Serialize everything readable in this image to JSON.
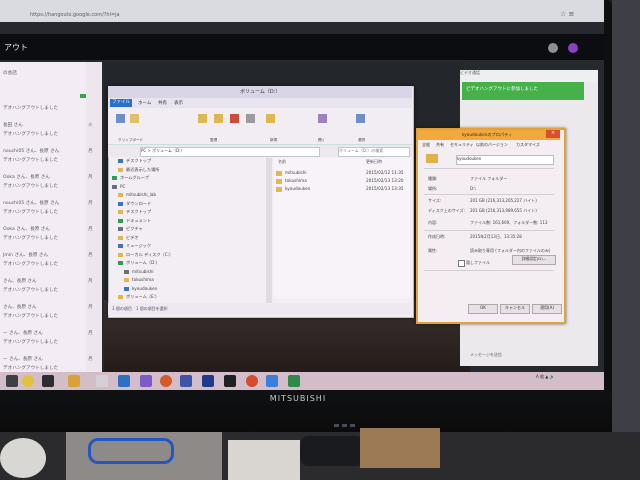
{
  "browser": {
    "url": "https://hangouts.google.com/?hl=ja",
    "chrome_icons": "☆ ≡"
  },
  "hangouts": {
    "title": "アウト",
    "conversations": [
      {
        "name": "の会話",
        "time": "",
        "msg": ""
      },
      {
        "name": "",
        "time": "",
        "msg": "デオハングアウトしました"
      },
      {
        "name": "長田 さん",
        "time": "火",
        "msg": "デオハングアウトしました"
      },
      {
        "name": "nouchi05 さん、長原 さん",
        "time": "月",
        "msg": "デオハングアウトしました"
      },
      {
        "name": "Ooka さん、長原 さん",
        "time": "月",
        "msg": "デオハングアウトしました"
      },
      {
        "name": "nouchi05 さん、長原 さん",
        "time": "月",
        "msg": "デオハングアウトしました"
      },
      {
        "name": "Ooka さん、長原 さん",
        "time": "月",
        "msg": "デオハングアウトしました"
      },
      {
        "name": "Jmin さん、長原 さん",
        "time": "月",
        "msg": "デオハングアウトしました"
      },
      {
        "name": "さん、長原 さん",
        "time": "月",
        "msg": "デオハングアウトしました"
      },
      {
        "name": "さん、長原 さん",
        "time": "月",
        "msg": "デオハングアウトしました"
      },
      {
        "name": "ー さん、長原 さん",
        "time": "月",
        "msg": "デオハングアウトしました"
      },
      {
        "name": "ー さん、長原 さん",
        "time": "月",
        "msg": "デオハングアウトしました"
      }
    ],
    "right_header": "ビデオ通話",
    "green_text": "ビデオハングアウトに参加しました",
    "message_input_placeholder": "メッセージを送信"
  },
  "explorer": {
    "title": "ボリューム（D:）",
    "tabs": [
      "ファイル",
      "ホーム",
      "共有",
      "表示"
    ],
    "address": "PC > ボリューム（D:）",
    "search_placeholder": "ボリューム（D:）の検索",
    "ribbon_groups": [
      "クリップボード",
      "整理",
      "新規",
      "開く",
      "選択"
    ],
    "nav": [
      {
        "label": "デスクトップ",
        "indent": 1
      },
      {
        "label": "最近表示した場所",
        "indent": 1
      },
      {
        "label": "ホームグループ",
        "indent": 0
      },
      {
        "label": "PC",
        "indent": 0
      },
      {
        "label": "mitsubishi_lab",
        "indent": 1
      },
      {
        "label": "ダウンロード",
        "indent": 1
      },
      {
        "label": "デスクトップ",
        "indent": 1
      },
      {
        "label": "ドキュメント",
        "indent": 1
      },
      {
        "label": "ピクチャ",
        "indent": 1
      },
      {
        "label": "ビデオ",
        "indent": 1
      },
      {
        "label": "ミュージック",
        "indent": 1
      },
      {
        "label": "ローカル ディスク（C:）",
        "indent": 1
      },
      {
        "label": "ボリューム（D:）",
        "indent": 1
      },
      {
        "label": "mitsubishi",
        "indent": 2
      },
      {
        "label": "tokushima",
        "indent": 2
      },
      {
        "label": "kyoudouken",
        "indent": 2
      },
      {
        "label": "ボリューム（E:）",
        "indent": 1
      }
    ],
    "columns": [
      "名前",
      "更新日時"
    ],
    "files": [
      {
        "name": "mitsubishi",
        "date": "2015/02/12 11:35"
      },
      {
        "name": "tokushima",
        "date": "2015/02/13 13:20"
      },
      {
        "name": "kyoudouken",
        "date": "2015/02/13 13:35"
      }
    ],
    "status": "3 個の項目　1 個の項目を選択"
  },
  "properties": {
    "title": "kyoudoukenのプロパティ",
    "tabs": [
      "全般",
      "共有",
      "セキュリティ",
      "以前のバージョン",
      "カスタマイズ"
    ],
    "name": "kyoudouken",
    "rows": [
      {
        "label": "種類:",
        "value": "ファイル フォルダー"
      },
      {
        "label": "場所:",
        "value": "D:\\"
      },
      {
        "label": "サイズ:",
        "value": "201 GB (216,313,205,227 バイト)"
      },
      {
        "label": "ディスク上のサイズ:",
        "value": "201 GB (216,313,989,655 バイト)"
      },
      {
        "label": "内容:",
        "value": "ファイル数: 161,669、フォルダー数: 113"
      },
      {
        "label": "作成日時:",
        "value": "2015年2月13日、13:35:28"
      },
      {
        "label": "属性:",
        "value": "読み取り専用 (フォルダー内のファイルのみ)"
      }
    ],
    "hidden_label": "隠しファイル",
    "advanced_button": "詳細設定(D)...",
    "buttons": [
      "OK",
      "キャンセル",
      "適用(A)"
    ]
  },
  "taskbar": {
    "tray_text": "A 般 ▲ 🔊"
  },
  "monitor": {
    "brand": "MITSUBISHI"
  },
  "colors": {
    "green": "#46b04a",
    "explorer_accent": "#2a6fc9",
    "dialog_border": "#e1a23a"
  }
}
